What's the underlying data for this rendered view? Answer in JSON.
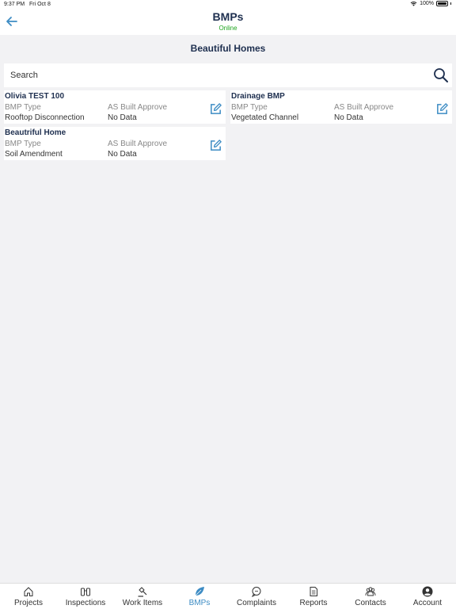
{
  "status": {
    "time": "9:37 PM",
    "date": "Fri Oct 8",
    "battery": "100%"
  },
  "header": {
    "title": "BMPs",
    "subtitle": "Online"
  },
  "project_name": "Beautiful Homes",
  "search": {
    "placeholder": "Search"
  },
  "bmps": [
    {
      "name": "Olivia TEST 100",
      "type_label": "BMP Type",
      "type": "Rooftop Disconnection",
      "status_label": "AS Built Approve",
      "status": "No Data"
    },
    {
      "name": "Drainage BMP",
      "type_label": "BMP Type",
      "type": "Vegetated Channel",
      "status_label": "AS Built Approve",
      "status": "No Data"
    },
    {
      "name": "Beautriful Home",
      "type_label": "BMP Type",
      "type": "Soil Amendment",
      "status_label": "AS Built Approve",
      "status": "No Data"
    }
  ],
  "tabs": [
    {
      "label": "Projects",
      "icon": "house-icon"
    },
    {
      "label": "Inspections",
      "icon": "binoculars-icon"
    },
    {
      "label": "Work Items",
      "icon": "gavel-icon"
    },
    {
      "label": "BMPs",
      "icon": "leaf-icon",
      "active": true
    },
    {
      "label": "Complaints",
      "icon": "chat-bubble-icon"
    },
    {
      "label": "Reports",
      "icon": "document-icon"
    },
    {
      "label": "Contacts",
      "icon": "people-icon"
    },
    {
      "label": "Account",
      "icon": "account-icon"
    }
  ],
  "colors": {
    "accent": "#3d8cc4",
    "title": "#1e2f4f",
    "online": "#1fa51f"
  }
}
